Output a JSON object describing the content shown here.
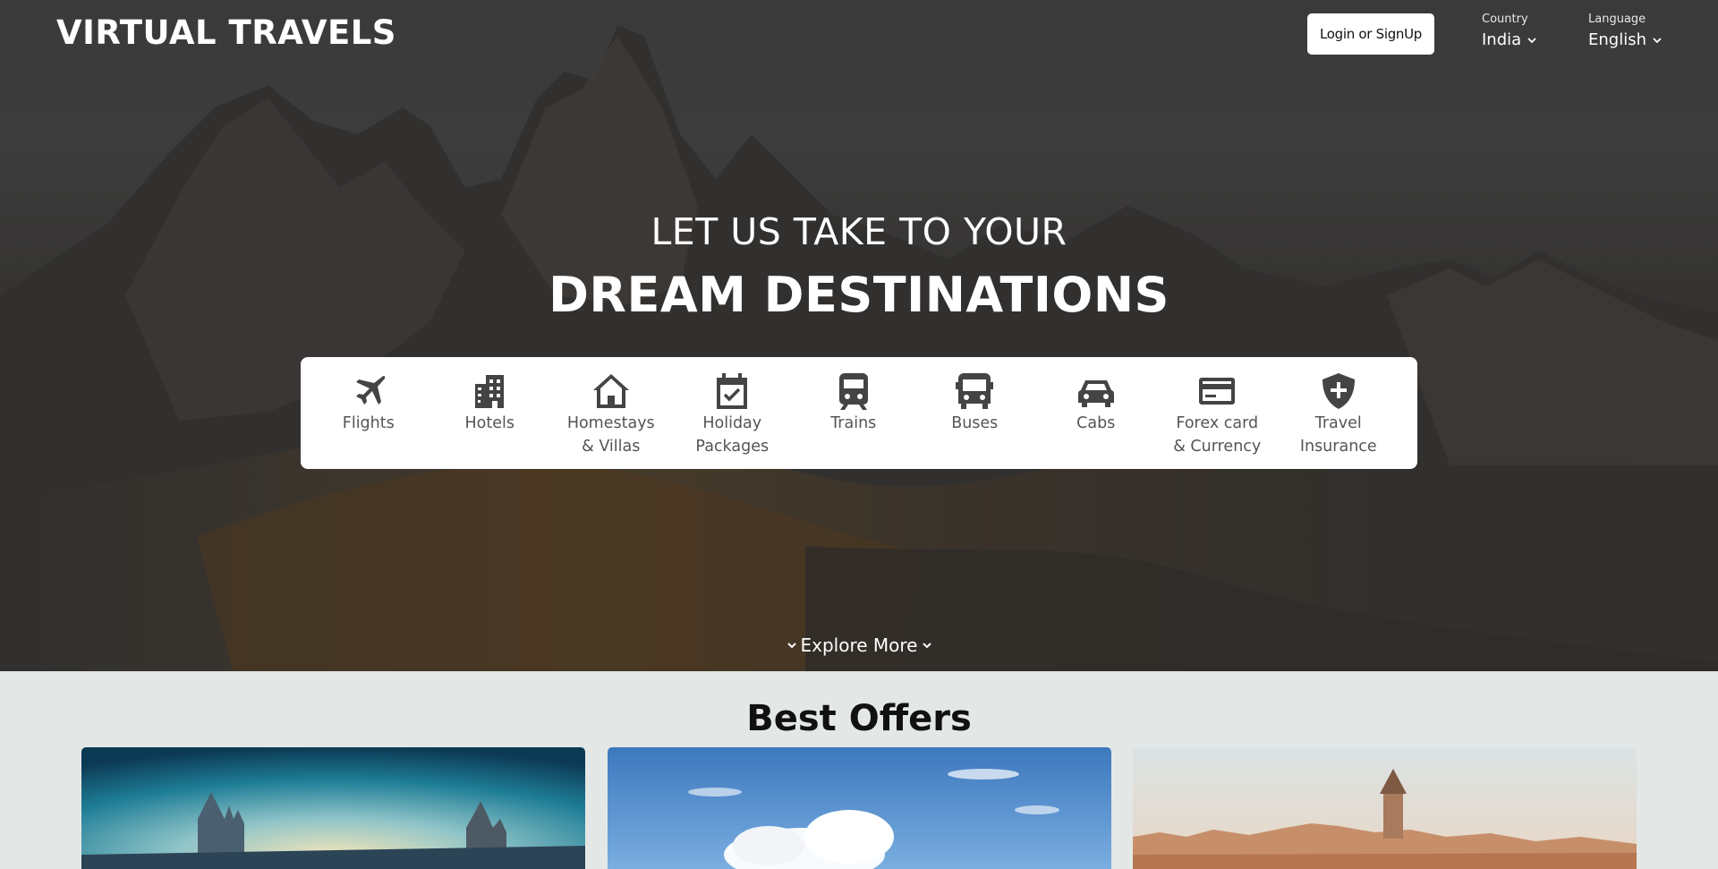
{
  "header": {
    "logo": "VIRTUAL TRAVELS",
    "login_label": "Login or SignUp",
    "country": {
      "label": "Country",
      "value": "India"
    },
    "language": {
      "label": "Language",
      "value": "English"
    }
  },
  "hero": {
    "line1": "LET US TAKE TO YOUR",
    "line2": "DREAM DESTINATIONS"
  },
  "services": [
    {
      "label": "Flights",
      "icon": "airplane-icon"
    },
    {
      "label": "Hotels",
      "icon": "building-icon"
    },
    {
      "label": "Homestays\n& Villas",
      "icon": "house-icon"
    },
    {
      "label": "Holiday\nPackages",
      "icon": "calendar-check-icon"
    },
    {
      "label": "Trains",
      "icon": "train-icon"
    },
    {
      "label": "Buses",
      "icon": "bus-icon"
    },
    {
      "label": "Cabs",
      "icon": "car-icon"
    },
    {
      "label": "Forex card\n& Currency",
      "icon": "credit-card-icon"
    },
    {
      "label": "Travel\nInsurance",
      "icon": "shield-plus-icon"
    }
  ],
  "explore_label": "Explore More",
  "offers": {
    "title": "Best Offers"
  },
  "colors": {
    "accent": "#ffffff",
    "offers_background": "#e3e7e6",
    "icon": "#444444"
  }
}
